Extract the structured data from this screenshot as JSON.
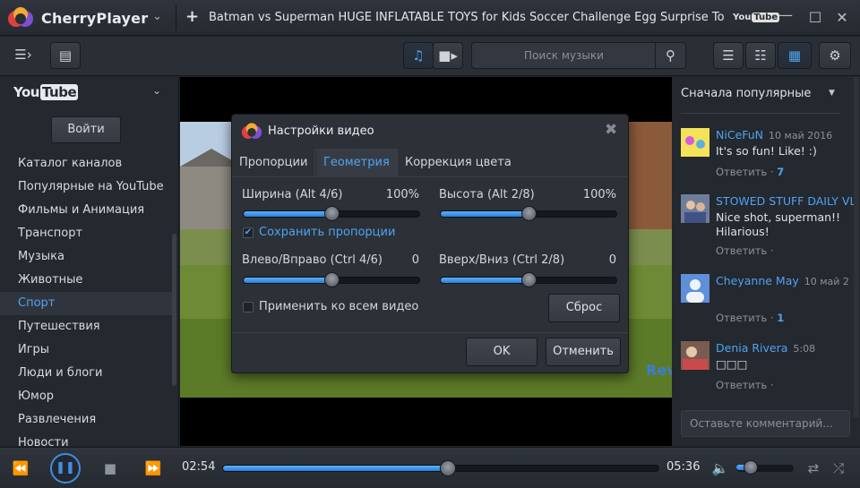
{
  "app": {
    "name": "CherryPlayer",
    "video_title": "Batman vs Superman HUGE INFLATABLE TOYS for Kids Soccer Challenge Egg Surprise To...",
    "source_badge_you": "You",
    "source_badge_tube": "Tube"
  },
  "toolbar": {
    "search_placeholder": "Поиск музыки"
  },
  "sidebar": {
    "service_you": "You",
    "service_tube": "Tube",
    "login_label": "Войти",
    "items": [
      {
        "label": "Каталог каналов"
      },
      {
        "label": "Популярные на YouTube"
      },
      {
        "label": "Фильмы и Анимация"
      },
      {
        "label": "Транспорт"
      },
      {
        "label": "Музыка"
      },
      {
        "label": "Животные"
      },
      {
        "label": "Спорт"
      },
      {
        "label": "Путешествия"
      },
      {
        "label": "Игры"
      },
      {
        "label": "Люди и блоги"
      },
      {
        "label": "Юмор"
      },
      {
        "label": "Развлечения"
      },
      {
        "label": "Новости"
      }
    ],
    "active_index": 6
  },
  "comments": {
    "sort_label": "Сначала популярные",
    "input_placeholder": "Оставьте комментарий...",
    "items": [
      {
        "author": "NiCeFuN",
        "date": "10 май 2016",
        "text": "It's so fun! Like! :)",
        "reply": "Ответить",
        "likes": "7"
      },
      {
        "author": "STOWED STUFF DAILY VL",
        "date": "",
        "text": "Nice shot, superman!! Hilarious!",
        "reply": "Ответить",
        "likes": ""
      },
      {
        "author": "Cheyanne May",
        "date": "10 май 2",
        "text": "",
        "reply": "Ответить",
        "likes": "1"
      },
      {
        "author": "Denia Rivera",
        "date": "5:08",
        "text": "□□□",
        "reply": "Ответить",
        "likes": ""
      }
    ]
  },
  "dialog": {
    "title": "Настройки видео",
    "tabs": [
      "Пропорции",
      "Геометрия",
      "Коррекция цвета"
    ],
    "active_tab": 1,
    "width_label": "Ширина (Alt 4/6)",
    "width_value": "100%",
    "height_label": "Высота (Alt 2/8)",
    "height_value": "100%",
    "keep_aspect_label": "Сохранить пропорции",
    "keep_aspect_checked": true,
    "horiz_label": "Влево/Вправо (Ctrl 4/6)",
    "horiz_value": "0",
    "vert_label": "Вверх/Вниз (Ctrl 2/8)",
    "vert_value": "0",
    "apply_all_label": "Применить ко всем видео",
    "apply_all_checked": false,
    "reset_label": "Сброс",
    "ok_label": "OK",
    "cancel_label": "Отменить",
    "sliders_fraction": {
      "width": 0.5,
      "height": 0.5,
      "horiz": 0.5,
      "vert": 0.5
    }
  },
  "video": {
    "watermark": "Review"
  },
  "player": {
    "current_time": "02:54",
    "total_time": "05:36",
    "progress_fraction": 0.516,
    "volume_fraction": 0.25
  },
  "colors": {
    "accent": "#4fa3f1",
    "background": "#23272e"
  }
}
